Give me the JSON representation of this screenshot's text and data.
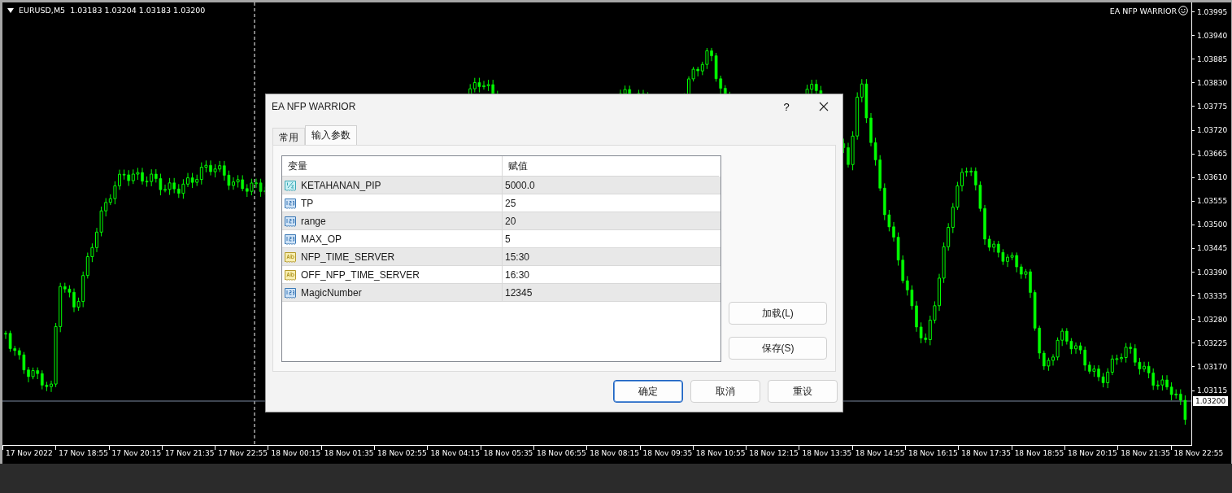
{
  "chart": {
    "symbol_info": "EURUSD,M5  1.03183 1.03204 1.03183 1.03200",
    "expert_name": "EA NFP WARRIOR",
    "price_axis": [
      "1.03995",
      "1.03940",
      "1.03885",
      "1.03830",
      "1.03775",
      "1.03720",
      "1.03665",
      "1.03610",
      "1.03555",
      "1.03500",
      "1.03445",
      "1.03390",
      "1.03335",
      "1.03280",
      "1.03225",
      "1.03170",
      "1.03115"
    ],
    "current_price": "1.03200",
    "time_axis": [
      "17 Nov 2022",
      "17 Nov 18:55",
      "17 Nov 20:15",
      "17 Nov 21:35",
      "17 Nov 22:55",
      "18 Nov 00:15",
      "18 Nov 01:35",
      "18 Nov 02:55",
      "18 Nov 04:15",
      "18 Nov 05:35",
      "18 Nov 06:55",
      "18 Nov 08:15",
      "18 Nov 09:35",
      "18 Nov 10:55",
      "18 Nov 12:15",
      "18 Nov 13:35",
      "18 Nov 14:55",
      "18 Nov 16:15",
      "18 Nov 17:35",
      "18 Nov 18:55",
      "18 Nov 20:15",
      "18 Nov 21:35",
      "18 Nov 22:55"
    ]
  },
  "dialog": {
    "title": "EA NFP WARRIOR",
    "help_button": "?",
    "tabs": [
      {
        "label": "常用",
        "selected": false
      },
      {
        "label": "输入参数",
        "selected": true
      }
    ],
    "table": {
      "columns": [
        "变量",
        "赋值"
      ],
      "rows": [
        {
          "kind": "double",
          "name": "KETAHANAN_PIP",
          "value": "5000.0"
        },
        {
          "kind": "int",
          "name": "TP",
          "value": "25"
        },
        {
          "kind": "int",
          "name": "range",
          "value": "20"
        },
        {
          "kind": "int",
          "name": "MAX_OP",
          "value": "5"
        },
        {
          "kind": "string",
          "name": "NFP_TIME_SERVER",
          "value": "15:30"
        },
        {
          "kind": "string",
          "name": "OFF_NFP_TIME_SERVER",
          "value": "16:30"
        },
        {
          "kind": "int",
          "name": "MagicNumber",
          "value": "12345"
        }
      ]
    },
    "side_buttons": [
      "加载(L)",
      "保存(S)"
    ],
    "buttons": [
      {
        "label": "确定",
        "default": true
      },
      {
        "label": "取消",
        "default": false
      },
      {
        "label": "重设",
        "default": false
      }
    ]
  }
}
